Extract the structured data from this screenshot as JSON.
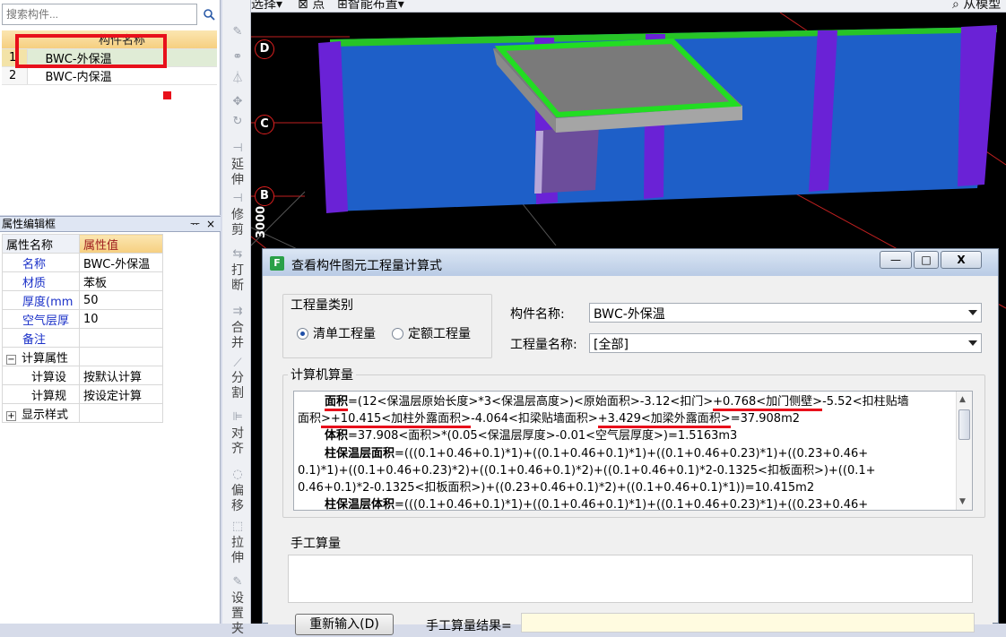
{
  "left_panel": {
    "search_placeholder": "搜索构件...",
    "table_header": "构件名称",
    "rows": [
      {
        "index": "1",
        "name": "BWC-外保温",
        "selected": true
      },
      {
        "index": "2",
        "name": "BWC-内保温",
        "selected": false
      }
    ]
  },
  "properties": {
    "panel_title": "属性编辑框",
    "pin_label": "ᅲ",
    "close_label": "×",
    "col_name": "属性名称",
    "col_value": "属性值",
    "rows": [
      {
        "key": "名称",
        "value": "BWC-外保温"
      },
      {
        "key": "材质",
        "value": "苯板"
      },
      {
        "key": "厚度(mm",
        "value": "50"
      },
      {
        "key": "空气层厚",
        "value": "10"
      },
      {
        "key": "备注",
        "value": ""
      }
    ],
    "group_calc": "计算属性",
    "calc_rows": [
      {
        "key": "计算设",
        "value": "按默认计算"
      },
      {
        "key": "计算规",
        "value": "按设定计算"
      }
    ],
    "group_display": "显示样式"
  },
  "middle_toolbar": {
    "extend": "延伸",
    "trim": "修剪",
    "break": "打断",
    "merge": "合并",
    "split": "分割",
    "align": "对齐",
    "offset": "偏移",
    "stretch": "拉伸",
    "settings": "设置夹"
  },
  "top_toolbar": {
    "select": "选择",
    "point": "点",
    "smart_layout": "智能布置",
    "from_model": "从模型"
  },
  "viewport": {
    "axis_d": "D",
    "axis_c": "C",
    "axis_b": "B",
    "dimension_text": "3000"
  },
  "dialog": {
    "title": "查看构件图元工程量计算式",
    "min_label": "—",
    "max_label": "□",
    "close_label": "X",
    "quantity_type_legend": "工程量类别",
    "radio_bill": "清单工程量",
    "radio_quota": "定额工程量",
    "component_name_label": "构件名称:",
    "component_name_value": "BWC-外保温",
    "quantity_name_label": "工程量名称:",
    "quantity_name_value": "[全部]",
    "calc_legend": "计算机算量",
    "manual_legend": "手工算量",
    "reinput_button": "重新输入(D)",
    "manual_result_label": "手工算量结果=",
    "calc_lines": {
      "l1_label": "面积",
      "l1_a": "=(12<保温层原始长度>*3<保温层高度>)<原始面积>-3.12<扣门>",
      "l1_b": "+0.768<加门侧壁>",
      "l1_c": "-5.52<扣柱贴墙",
      "l2_a": "面积",
      "l2_b": ">+10.415<加柱外露面积>",
      "l2_c": "-4.064<扣梁贴墙面积>",
      "l2_d": "+3.429<加梁外露面积>",
      "l2_e": "=37.908m2",
      "l3_label": "体积",
      "l3_text": "=37.908<面积>*(0.05<保温层厚度>-0.01<空气层厚度>)=1.5163m3",
      "l4_label": "柱保温层面积",
      "l4_text": "=(((0.1+0.46+0.1)*1)+((0.1+0.46+0.1)*1)+((0.1+0.46+0.23)*1)+((0.23+0.46+",
      "l5_text": "0.1)*1)+((0.1+0.46+0.23)*2)+((0.1+0.46+0.1)*2)+((0.1+0.46+0.1)*2-0.1325<扣板面积>)+((0.1+",
      "l6_text": "0.46+0.1)*2-0.1325<扣板面积>)+((0.23+0.46+0.1)*2)+((0.1+0.46+0.1)*1))=10.415m2",
      "l7_label": "柱保温层体积",
      "l7_text": "=(((0.1+0.46+0.1)*1)+((0.1+0.46+0.1)*1)+((0.1+0.46+0.23)*1)+((0.23+0.46+"
    }
  }
}
